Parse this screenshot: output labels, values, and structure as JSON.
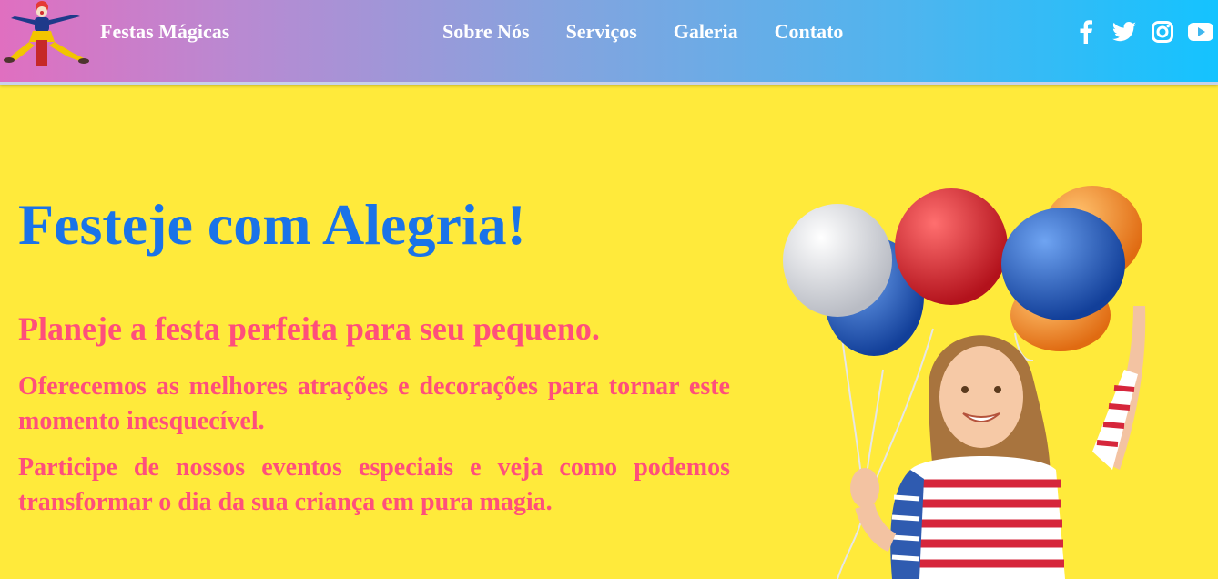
{
  "header": {
    "brand": "Festas Mágicas",
    "logo_icon": "clown-logo",
    "nav": [
      "Sobre Nós",
      "Serviços",
      "Galeria",
      "Contato"
    ],
    "social": [
      "facebook-icon",
      "twitter-icon",
      "instagram-icon",
      "youtube-icon"
    ]
  },
  "hero": {
    "title": "Festeje com Alegria!",
    "subtitle": "Planeje a festa perfeita para seu pequeno.",
    "paragraph1": "Oferecemos as melhores atrações e decorações para tornar este momento inesquecível.",
    "paragraph2": "Participe de nossos eventos especiais e veja como podemos transformar o dia da sua criança em pura magia.",
    "image": "girl-with-balloons"
  },
  "colors": {
    "background": "#ffea3b",
    "title": "#1a73e8",
    "text": "#ff4f7b",
    "header_start": "#e06fc0",
    "header_end": "#14c3ff"
  }
}
